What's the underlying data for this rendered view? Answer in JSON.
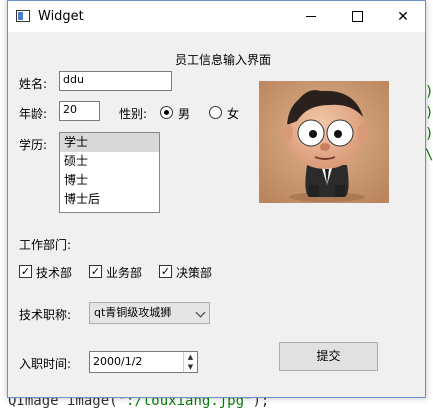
{
  "window": {
    "title": "Widget"
  },
  "form": {
    "heading": "员工信息输入界面",
    "name_label": "姓名:",
    "name_value": "ddu",
    "age_label": "年龄:",
    "age_value": "20",
    "gender_label": "性别:",
    "gender_options": [
      "男",
      "女"
    ],
    "gender_selected": "男",
    "education_label": "学历:",
    "education_items": [
      "学士",
      "硕士",
      "博士",
      "博士后"
    ],
    "education_selected": "学士",
    "department_label": "工作部门:",
    "departments": [
      {
        "label": "技术部",
        "checked": true
      },
      {
        "label": "业务部",
        "checked": true
      },
      {
        "label": "决策部",
        "checked": true
      }
    ],
    "title_label": "技术职称:",
    "title_value": "qt青铜级攻城狮",
    "join_date_label": "入职时间:",
    "join_date_value": "2000/1/2",
    "submit_label": "提交"
  },
  "background_code": {
    "prefix": "QImage image(\"",
    "string": ":/touxiang.jpg",
    "suffix": "\");"
  },
  "colors": {
    "window_border": "#6b8fd1",
    "window_bg": "#f0f0f0",
    "avatar_bg": "#c89770"
  },
  "icons": [
    "app-icon",
    "minimize-icon",
    "maximize-icon",
    "close-icon",
    "chevron-down-icon",
    "spin-up-icon",
    "spin-down-icon",
    "check-icon"
  ]
}
